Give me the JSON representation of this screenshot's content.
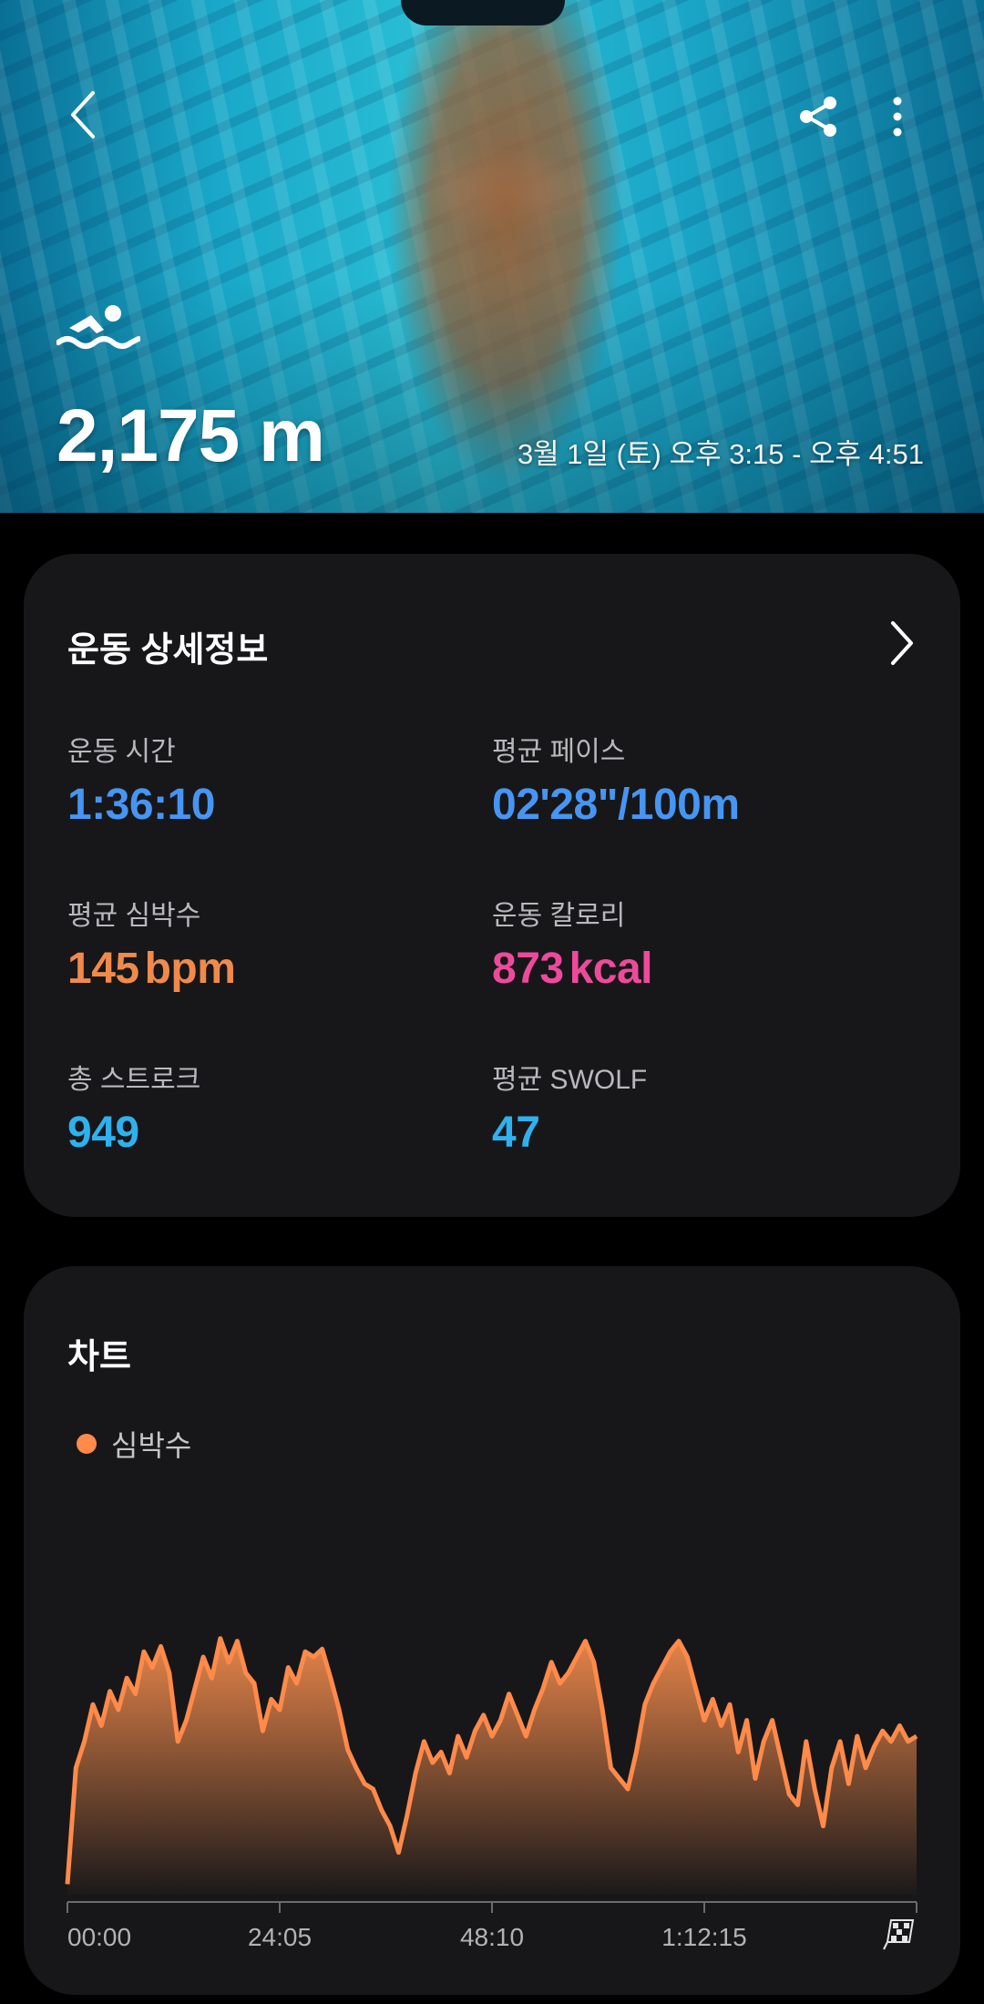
{
  "header": {
    "distance": "2,175 m",
    "datetime": "3월 1일 (토) 오후 3:15 - 오후 4:51"
  },
  "details": {
    "title": "운동 상세정보",
    "duration": {
      "label": "운동 시간",
      "value": "1:36:10"
    },
    "avg_pace": {
      "label": "평균 페이스",
      "value": "02'28\"/100m"
    },
    "avg_hr": {
      "label": "평균 심박수",
      "value": "145",
      "unit": "bpm"
    },
    "calories": {
      "label": "운동 칼로리",
      "value": "873",
      "unit": "kcal"
    },
    "strokes": {
      "label": "총 스트로크",
      "value": "949"
    },
    "avg_swolf": {
      "label": "평균 SWOLF",
      "value": "47"
    }
  },
  "chart_section": {
    "title": "차트",
    "legend": "심박수"
  },
  "colors": {
    "background": "#000000",
    "card": "#171719",
    "blue": "#4795f3",
    "orange": "#f08a4c",
    "pink": "#ee4a9b",
    "sky": "#2fb1ee",
    "heart_rate_line": "#ff8a4a"
  },
  "icons": {
    "back": "chevron-left-icon",
    "share": "share-icon",
    "more": "more-vertical-icon",
    "activity": "swimming-icon",
    "details_link": "chevron-right-icon",
    "finish": "checkered-flag-icon"
  },
  "chart_data": {
    "type": "area",
    "x_tick_labels": [
      "00:00",
      "24:05",
      "48:10",
      "1:12:15"
    ],
    "end_marker": "finish",
    "series": [
      {
        "name": "심박수",
        "x_fraction": [
          0,
          0.01,
          0.02,
          0.03,
          0.04,
          0.05,
          0.06,
          0.07,
          0.08,
          0.09,
          0.1,
          0.11,
          0.12,
          0.13,
          0.14,
          0.15,
          0.16,
          0.17,
          0.18,
          0.19,
          0.2,
          0.21,
          0.22,
          0.23,
          0.24,
          0.25,
          0.26,
          0.27,
          0.28,
          0.29,
          0.3,
          0.31,
          0.32,
          0.33,
          0.34,
          0.35,
          0.36,
          0.37,
          0.38,
          0.39,
          0.4,
          0.41,
          0.42,
          0.43,
          0.44,
          0.45,
          0.46,
          0.47,
          0.48,
          0.49,
          0.5,
          0.51,
          0.52,
          0.53,
          0.54,
          0.55,
          0.56,
          0.57,
          0.58,
          0.59,
          0.6,
          0.61,
          0.62,
          0.63,
          0.64,
          0.65,
          0.66,
          0.67,
          0.68,
          0.69,
          0.7,
          0.71,
          0.72,
          0.73,
          0.74,
          0.75,
          0.76,
          0.77,
          0.78,
          0.79,
          0.8,
          0.81,
          0.82,
          0.83,
          0.84,
          0.85,
          0.86,
          0.87,
          0.88,
          0.89,
          0.9,
          0.91,
          0.92,
          0.93,
          0.94,
          0.95,
          0.96,
          0.97,
          0.98,
          0.99,
          1.0
        ],
        "level_fraction": [
          0.04,
          0.48,
          0.58,
          0.72,
          0.64,
          0.77,
          0.7,
          0.82,
          0.76,
          0.92,
          0.86,
          0.94,
          0.84,
          0.58,
          0.66,
          0.78,
          0.9,
          0.82,
          0.97,
          0.88,
          0.96,
          0.84,
          0.8,
          0.62,
          0.74,
          0.7,
          0.86,
          0.8,
          0.92,
          0.9,
          0.93,
          0.82,
          0.7,
          0.55,
          0.48,
          0.42,
          0.4,
          0.32,
          0.26,
          0.16,
          0.3,
          0.46,
          0.58,
          0.5,
          0.54,
          0.46,
          0.6,
          0.52,
          0.62,
          0.68,
          0.6,
          0.66,
          0.76,
          0.68,
          0.6,
          0.7,
          0.78,
          0.88,
          0.8,
          0.84,
          0.9,
          0.96,
          0.88,
          0.7,
          0.48,
          0.44,
          0.4,
          0.54,
          0.72,
          0.8,
          0.86,
          0.92,
          0.96,
          0.9,
          0.78,
          0.66,
          0.74,
          0.64,
          0.72,
          0.54,
          0.66,
          0.44,
          0.58,
          0.66,
          0.52,
          0.38,
          0.34,
          0.58,
          0.4,
          0.26,
          0.48,
          0.58,
          0.42,
          0.6,
          0.48,
          0.56,
          0.62,
          0.58,
          0.64,
          0.58,
          0.6
        ]
      }
    ]
  }
}
